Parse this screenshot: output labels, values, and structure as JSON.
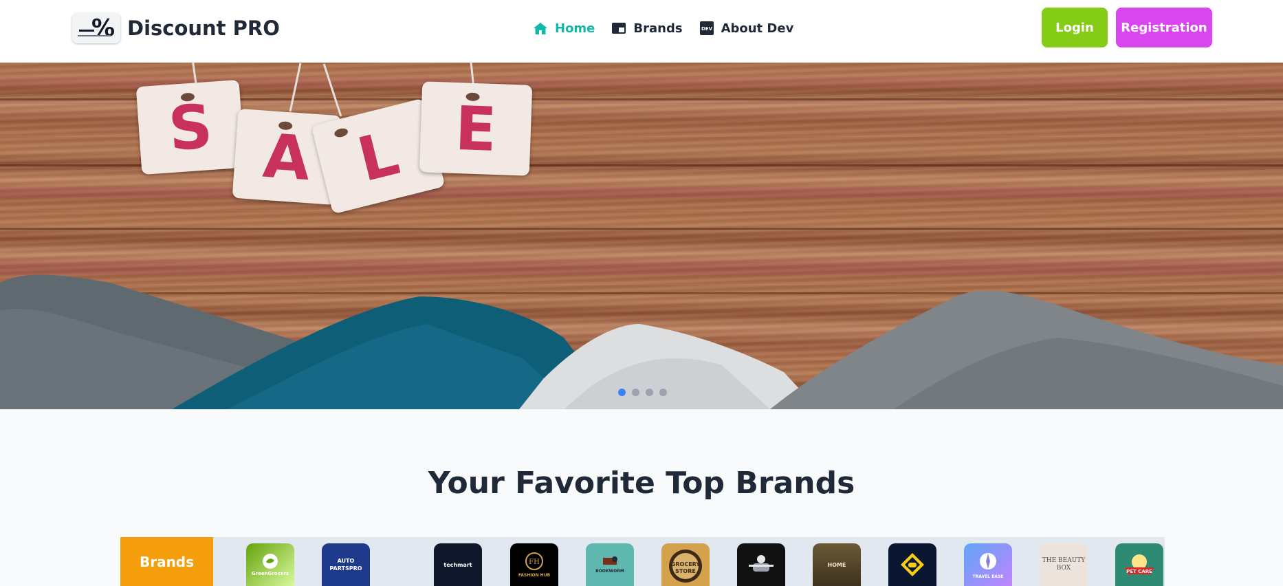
{
  "navbar": {
    "brand_name": "Discount PRO",
    "links": [
      {
        "label": "Home",
        "icon": "home-icon",
        "active": true
      },
      {
        "label": "Brands",
        "icon": "brands-icon",
        "active": false
      },
      {
        "label": "About Dev",
        "icon": "dev-icon",
        "active": false
      }
    ],
    "login_label": "Login",
    "register_label": "Registration"
  },
  "hero": {
    "tag_letters": [
      "S",
      "A",
      "L",
      "E"
    ],
    "slides_count": 4,
    "active_slide": 1
  },
  "section": {
    "title": "Your Favorite Top Brands"
  },
  "brands_strip": {
    "label": "Brands",
    "logos": [
      {
        "name": "GreenGrocers",
        "text": "GreenGrocers",
        "bg": "#84cc16"
      },
      {
        "name": "Auto PartsPro",
        "text": "AUTO PARTSPRO",
        "bg": "#1e3a8a"
      },
      {
        "name": "techmart",
        "text": "techmart",
        "bg": "#0f172a"
      },
      {
        "name": "Fashion Hub",
        "text": "FASHION HUB",
        "bg": "#000000"
      },
      {
        "name": "Bookworm",
        "text": "BOOKWORM",
        "bg": "#5eb8b0"
      },
      {
        "name": "Grocery Store",
        "text": "GROCERY STORE",
        "bg": "#d4a24c"
      },
      {
        "name": "Fitness",
        "text": "FITNESS",
        "bg": "#111111"
      },
      {
        "name": "Home Decor",
        "text": "HOME",
        "bg": "#5a4a2a"
      },
      {
        "name": "Gaming",
        "text": "GAMING",
        "bg": "#0b1630"
      },
      {
        "name": "Travel Ease",
        "text": "TRAVEL EASE",
        "bg": "#8b7fd6"
      },
      {
        "name": "The Beauty Box",
        "text": "THE BEAUTY BOX",
        "bg": "#ebe3dc"
      },
      {
        "name": "Pet Care",
        "text": "PET CARE",
        "bg": "#2f8a74"
      }
    ]
  },
  "colors": {
    "accent_teal": "#14b8a6",
    "login_green": "#84cc16",
    "register_magenta": "#d946ef",
    "brands_orange": "#f59e0b",
    "active_dot": "#3b82f6"
  }
}
